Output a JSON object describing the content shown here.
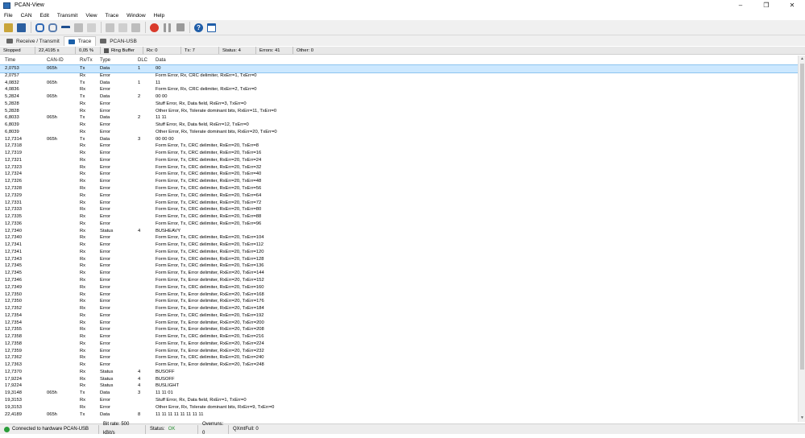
{
  "app": {
    "title": "PCAN-View"
  },
  "menu": [
    "File",
    "CAN",
    "Edit",
    "Transmit",
    "View",
    "Trace",
    "Window",
    "Help"
  ],
  "tabs": [
    {
      "label": "Receive / Transmit",
      "icon": "receive-transmit-icon"
    },
    {
      "label": "Trace",
      "icon": "trace-icon"
    },
    {
      "label": "PCAN-USB",
      "icon": "usb-icon"
    }
  ],
  "trace_status": {
    "state": "Stopped",
    "duration": "22,4195 s",
    "buffer_pct": "0,05 %",
    "buffer_mode": "Ring Buffer",
    "rx": "Rx: 0",
    "tx": "Tx: 7",
    "status": "Status: 4",
    "errors": "Errors: 41",
    "other": "Other: 0"
  },
  "columns": [
    "Time",
    "CAN-ID",
    "Rx/Tx",
    "Type",
    "DLC",
    "Data"
  ],
  "rows": [
    [
      "2,0753",
      "065h",
      "Tx",
      "Data",
      "1",
      "00"
    ],
    [
      "2,0757",
      "",
      "Rx",
      "Error",
      "",
      "Form Error, Rx, CRC delimiter, RxErr=1, TxErr=0"
    ],
    [
      "4,0832",
      "065h",
      "Tx",
      "Data",
      "1",
      "11"
    ],
    [
      "4,0836",
      "",
      "Rx",
      "Error",
      "",
      "Form Error, Rx, CRC delimiter, RxErr=2, TxErr=0"
    ],
    [
      "5,2824",
      "065h",
      "Tx",
      "Data",
      "2",
      "00 00"
    ],
    [
      "5,2828",
      "",
      "Rx",
      "Error",
      "",
      "Stuff Error, Rx, Data field, RxErr=3, TxErr=0"
    ],
    [
      "5,2828",
      "",
      "Rx",
      "Error",
      "",
      "Other Error, Rx, Tolerate dominant bits, RxErr=11, TxErr=0"
    ],
    [
      "6,8033",
      "065h",
      "Tx",
      "Data",
      "2",
      "11 11"
    ],
    [
      "6,8039",
      "",
      "Rx",
      "Error",
      "",
      "Stuff Error, Rx, Data field, RxErr=12, TxErr=0"
    ],
    [
      "6,8039",
      "",
      "Rx",
      "Error",
      "",
      "Other Error, Rx, Tolerate dominant bits, RxErr=20, TxErr=0"
    ],
    [
      "12,7314",
      "065h",
      "Tx",
      "Data",
      "3",
      "00 00 00"
    ],
    [
      "12,7318",
      "",
      "Rx",
      "Error",
      "",
      "Form Error, Tx, CRC delimiter, RxErr=20, TxErr=8"
    ],
    [
      "12,7319",
      "",
      "Rx",
      "Error",
      "",
      "Form Error, Tx, CRC delimiter, RxErr=20, TxErr=16"
    ],
    [
      "12,7321",
      "",
      "Rx",
      "Error",
      "",
      "Form Error, Tx, CRC delimiter, RxErr=20, TxErr=24"
    ],
    [
      "12,7323",
      "",
      "Rx",
      "Error",
      "",
      "Form Error, Tx, CRC delimiter, RxErr=20, TxErr=32"
    ],
    [
      "12,7324",
      "",
      "Rx",
      "Error",
      "",
      "Form Error, Tx, CRC delimiter, RxErr=20, TxErr=40"
    ],
    [
      "12,7326",
      "",
      "Rx",
      "Error",
      "",
      "Form Error, Tx, CRC delimiter, RxErr=20, TxErr=48"
    ],
    [
      "12,7328",
      "",
      "Rx",
      "Error",
      "",
      "Form Error, Tx, CRC delimiter, RxErr=20, TxErr=56"
    ],
    [
      "12,7329",
      "",
      "Rx",
      "Error",
      "",
      "Form Error, Tx, CRC delimiter, RxErr=20, TxErr=64"
    ],
    [
      "12,7331",
      "",
      "Rx",
      "Error",
      "",
      "Form Error, Tx, CRC delimiter, RxErr=20, TxErr=72"
    ],
    [
      "12,7333",
      "",
      "Rx",
      "Error",
      "",
      "Form Error, Tx, CRC delimiter, RxErr=20, TxErr=80"
    ],
    [
      "12,7335",
      "",
      "Rx",
      "Error",
      "",
      "Form Error, Tx, CRC delimiter, RxErr=20, TxErr=88"
    ],
    [
      "12,7336",
      "",
      "Rx",
      "Error",
      "",
      "Form Error, Tx, CRC delimiter, RxErr=20, TxErr=96"
    ],
    [
      "12,7340",
      "",
      "Rx",
      "Status",
      "4",
      "BUSHEAVY"
    ],
    [
      "12,7340",
      "",
      "Rx",
      "Error",
      "",
      "Form Error, Tx, CRC delimiter, RxErr=20, TxErr=104"
    ],
    [
      "12,7341",
      "",
      "Rx",
      "Error",
      "",
      "Form Error, Tx, CRC delimiter, RxErr=20, TxErr=112"
    ],
    [
      "12,7341",
      "",
      "Rx",
      "Error",
      "",
      "Form Error, Tx, CRC delimiter, RxErr=20, TxErr=120"
    ],
    [
      "12,7343",
      "",
      "Rx",
      "Error",
      "",
      "Form Error, Tx, CRC delimiter, RxErr=20, TxErr=128"
    ],
    [
      "12,7345",
      "",
      "Rx",
      "Error",
      "",
      "Form Error, Tx, CRC delimiter, RxErr=20, TxErr=136"
    ],
    [
      "12,7345",
      "",
      "Rx",
      "Error",
      "",
      "Form Error, Tx, Error delimiter, RxErr=20, TxErr=144"
    ],
    [
      "12,7346",
      "",
      "Rx",
      "Error",
      "",
      "Form Error, Tx, Error delimiter, RxErr=20, TxErr=152"
    ],
    [
      "12,7349",
      "",
      "Rx",
      "Error",
      "",
      "Form Error, Tx, CRC delimiter, RxErr=20, TxErr=160"
    ],
    [
      "12,7350",
      "",
      "Rx",
      "Error",
      "",
      "Form Error, Tx, Error delimiter, RxErr=20, TxErr=168"
    ],
    [
      "12,7350",
      "",
      "Rx",
      "Error",
      "",
      "Form Error, Tx, Error delimiter, RxErr=20, TxErr=176"
    ],
    [
      "12,7352",
      "",
      "Rx",
      "Error",
      "",
      "Form Error, Tx, Error delimiter, RxErr=20, TxErr=184"
    ],
    [
      "12,7354",
      "",
      "Rx",
      "Error",
      "",
      "Form Error, Tx, CRC delimiter, RxErr=20, TxErr=192"
    ],
    [
      "12,7354",
      "",
      "Rx",
      "Error",
      "",
      "Form Error, Tx, Error delimiter, RxErr=20, TxErr=200"
    ],
    [
      "12,7355",
      "",
      "Rx",
      "Error",
      "",
      "Form Error, Tx, Error delimiter, RxErr=20, TxErr=208"
    ],
    [
      "12,7358",
      "",
      "Rx",
      "Error",
      "",
      "Form Error, Tx, CRC delimiter, RxErr=20, TxErr=216"
    ],
    [
      "12,7358",
      "",
      "Rx",
      "Error",
      "",
      "Form Error, Tx, Error delimiter, RxErr=20, TxErr=224"
    ],
    [
      "12,7359",
      "",
      "Rx",
      "Error",
      "",
      "Form Error, Tx, Error delimiter, RxErr=20, TxErr=232"
    ],
    [
      "12,7362",
      "",
      "Rx",
      "Error",
      "",
      "Form Error, Tx, CRC delimiter, RxErr=20, TxErr=240"
    ],
    [
      "12,7363",
      "",
      "Rx",
      "Error",
      "",
      "Form Error, Tx, Error delimiter, RxErr=20, TxErr=248"
    ],
    [
      "12,7370",
      "",
      "Rx",
      "Status",
      "4",
      "BUSOFF"
    ],
    [
      "17,9224",
      "",
      "Rx",
      "Status",
      "4",
      "BUSOFF"
    ],
    [
      "17,9224",
      "",
      "Rx",
      "Status",
      "4",
      "BUSLIGHT"
    ],
    [
      "19,3148",
      "065h",
      "Tx",
      "Data",
      "3",
      "11 11 01"
    ],
    [
      "19,3153",
      "",
      "Rx",
      "Error",
      "",
      "Stuff Error, Rx, Data field, RxErr=1, TxErr=0"
    ],
    [
      "19,3153",
      "",
      "Rx",
      "Error",
      "",
      "Other Error, Rx, Tolerate dominant bits, RxErr=9, TxErr=0"
    ],
    [
      "22,4189",
      "065h",
      "Tx",
      "Data",
      "8",
      "11 11 11 11 11 11 11 11"
    ]
  ],
  "statusbar": {
    "connection": "Connected to hardware PCAN-USB",
    "bitrate": "Bit rate: 500 kBit/s",
    "status_label": "Status:",
    "status_value": "OK",
    "overruns": "Overruns: 0",
    "qxmtfull": "QXmtFull: 0"
  },
  "colors": {
    "selection": "#cce8ff",
    "record": "#d93a2b",
    "ok": "#2a8f34",
    "accent": "#1a5fa8"
  }
}
